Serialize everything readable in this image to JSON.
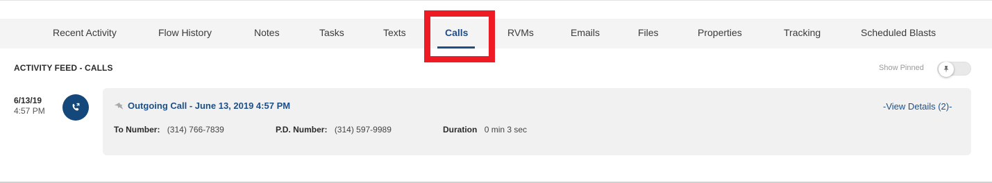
{
  "tabs": [
    {
      "label": "Recent Activity"
    },
    {
      "label": "Flow History"
    },
    {
      "label": "Notes"
    },
    {
      "label": "Tasks"
    },
    {
      "label": "Texts"
    },
    {
      "label": "Calls",
      "active": true
    },
    {
      "label": "RVMs"
    },
    {
      "label": "Emails"
    },
    {
      "label": "Files"
    },
    {
      "label": "Properties"
    },
    {
      "label": "Tracking"
    },
    {
      "label": "Scheduled Blasts"
    }
  ],
  "feed": {
    "title": "ACTIVITY FEED - CALLS",
    "show_pinned_label": "Show Pinned",
    "show_pinned_on": false
  },
  "entry": {
    "date": "6/13/19",
    "time": "4:57 PM",
    "icon": "phone-icon",
    "title": "Outgoing Call - June 13, 2019 4:57 PM",
    "view_details": "-View Details (2)-",
    "to_number_label": "To Number:",
    "to_number": "(314) 766-7839",
    "pd_number_label": "P.D. Number:",
    "pd_number": "(314) 597-9989",
    "duration_label": "Duration",
    "duration": "0 min 3 sec"
  },
  "colors": {
    "accent": "#1d4f86",
    "badge": "#14477a",
    "highlight": "#ee1b24",
    "card_bg": "#f1f1f1",
    "tabbar_bg": "#f4f4f4"
  }
}
